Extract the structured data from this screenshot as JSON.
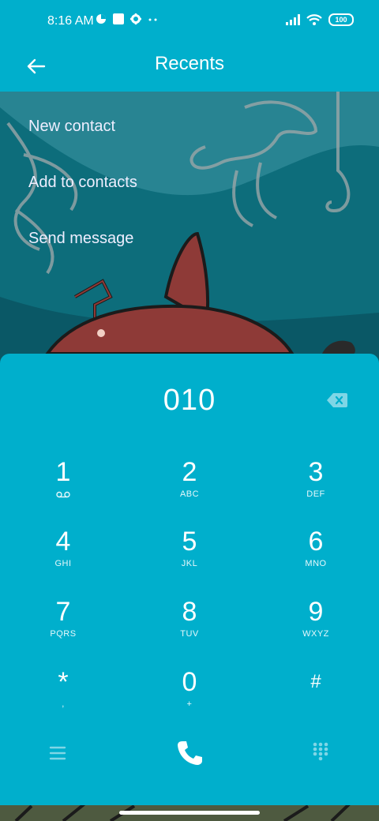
{
  "status_bar": {
    "time": "8:16 AM",
    "battery": "100"
  },
  "app_bar": {
    "title": "Recents"
  },
  "menu": {
    "items": [
      "New contact",
      "Add to contacts",
      "Send message"
    ]
  },
  "dialer": {
    "number": "010",
    "keys": [
      {
        "digit": "1",
        "letters": ""
      },
      {
        "digit": "2",
        "letters": "ABC"
      },
      {
        "digit": "3",
        "letters": "DEF"
      },
      {
        "digit": "4",
        "letters": "GHI"
      },
      {
        "digit": "5",
        "letters": "JKL"
      },
      {
        "digit": "6",
        "letters": "MNO"
      },
      {
        "digit": "7",
        "letters": "PQRS"
      },
      {
        "digit": "8",
        "letters": "TUV"
      },
      {
        "digit": "9",
        "letters": "WXYZ"
      },
      {
        "digit": "*",
        "letters": ","
      },
      {
        "digit": "0",
        "letters": "+"
      },
      {
        "digit": "#",
        "letters": ""
      }
    ]
  },
  "colors": {
    "accent": "#00afcc",
    "wallpaper_dark": "#0b5f6e"
  },
  "icons": [
    "back-arrow-icon",
    "voicemail-icon",
    "backspace-icon",
    "menu-icon",
    "phone-call-icon",
    "dialpad-icon"
  ]
}
